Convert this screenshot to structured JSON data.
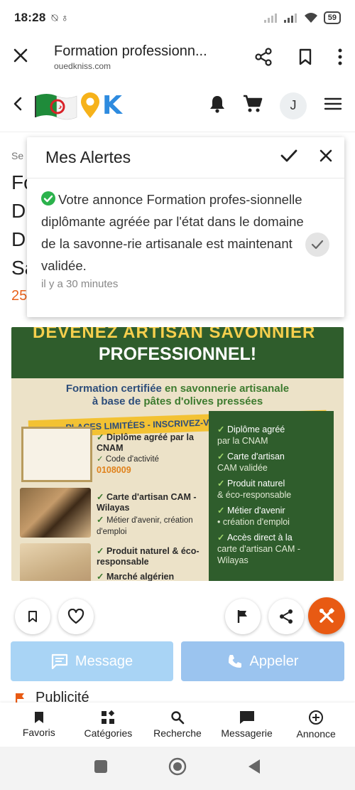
{
  "status_bar": {
    "time": "18:28",
    "left_icons": "⍉ ♁",
    "battery": "59"
  },
  "browser": {
    "title": "Formation professionn...",
    "domain": "ouedkniss.com"
  },
  "header": {
    "logo_text": "OK",
    "avatar_initial": "J"
  },
  "page": {
    "breadcrumb_fragment": "Se",
    "title_fragments": [
      "Fo",
      "D",
      "D",
      "Sa"
    ],
    "price_fragment": "25"
  },
  "alerts": {
    "title": "Mes Alertes",
    "items": [
      {
        "text": "Votre annonce Formation profes-sionnelle diplômante agréée par l'état dans le domaine de la savonne-rie artisanale est maintenant validée.",
        "time": "il y a 30 minutes"
      }
    ]
  },
  "ad_image": {
    "headline_1": "DEVENEZ ARTISAN SAVONNIER",
    "headline_2": "PROFESSIONNEL!",
    "sub_1a": "Formation certifiée",
    "sub_1b": " en savonnerie artisanale",
    "sub_2a": "à base de ",
    "sub_2b": "pâtes d'olives pressées",
    "banner": "PLACES LIMITÉES - INSCRIVEZ-VOUS MAINTENANT",
    "left_points": [
      {
        "title": "Diplôme agréé par la CNAM",
        "sub": "Code d'activité",
        "code": "0108009"
      },
      {
        "title": "Carte d'artisan CAM - Wilayas"
      },
      {
        "title": "Métier d'avenir, création d'emploi"
      },
      {
        "title": "Produit naturel & éco-responsable"
      },
      {
        "title": "Marché algérien"
      }
    ],
    "right_points": [
      {
        "title": "Diplôme agréé",
        "sub": "par la CNAM"
      },
      {
        "title": "Carte d'artisan",
        "sub": "CAM validée"
      },
      {
        "title": "Produit naturel",
        "sub": "& éco-responsable"
      },
      {
        "title": "Métier d'avenir",
        "sub": "• création d'emploi"
      },
      {
        "title": "Accès direct à la",
        "sub": "carte d'artisan CAM - Wilayas"
      }
    ]
  },
  "buttons": {
    "message": "Message",
    "call": "Appeler"
  },
  "publicite": "Publicité",
  "bottom_nav": [
    {
      "label": "Favoris",
      "icon": "bookmark-icon"
    },
    {
      "label": "Catégories",
      "icon": "categories-icon"
    },
    {
      "label": "Recherche",
      "icon": "search-icon"
    },
    {
      "label": "Messagerie",
      "icon": "chat-icon"
    },
    {
      "label": "Annonce",
      "icon": "add-circle-icon"
    }
  ],
  "colors": {
    "accent_orange": "#e85a13",
    "check_green": "#2bb24c",
    "message_btn": "#a9d4f5",
    "call_btn": "#9bc4ef"
  }
}
